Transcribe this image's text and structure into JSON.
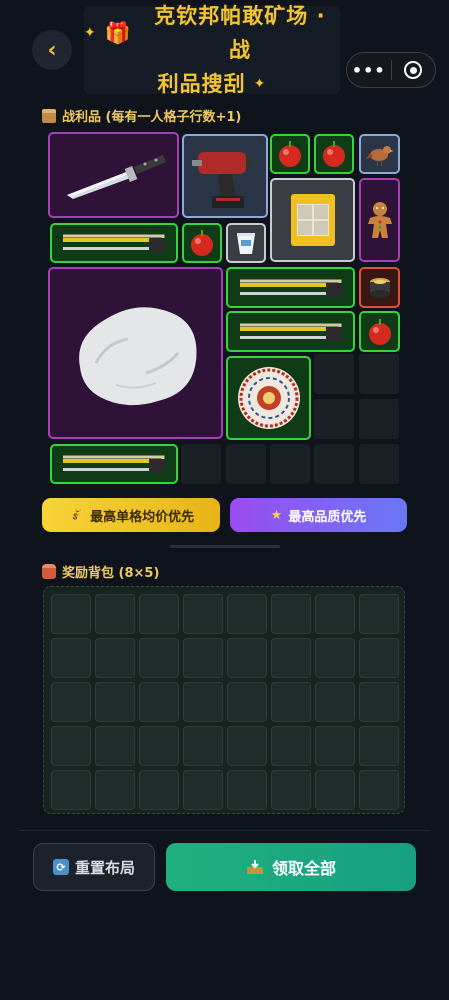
{
  "header": {
    "back_icon": "chevron-left-icon",
    "title_line1": "克钦邦帕敢矿场 · 战",
    "title_line2": "利品搜刮",
    "title_emoji": "🎁",
    "capsule_more": "•••",
    "accent": "#f4c430"
  },
  "loot_section": {
    "label": "战利品 (每有一人格子行数+1)",
    "items": [
      {
        "name": "knife",
        "rarity": "purple"
      },
      {
        "name": "drill",
        "rarity": "blue"
      },
      {
        "name": "apple",
        "rarity": "green"
      },
      {
        "name": "apple",
        "rarity": "green"
      },
      {
        "name": "bird",
        "rarity": "blue"
      },
      {
        "name": "wax-box",
        "rarity": "gray"
      },
      {
        "name": "gingerbread",
        "rarity": "purple"
      },
      {
        "name": "hacksaw",
        "rarity": "green"
      },
      {
        "name": "apple",
        "rarity": "green"
      },
      {
        "name": "cup",
        "rarity": "gray"
      },
      {
        "name": "rock",
        "rarity": "purple"
      },
      {
        "name": "hacksaw",
        "rarity": "green"
      },
      {
        "name": "jar",
        "rarity": "red"
      },
      {
        "name": "hacksaw",
        "rarity": "green"
      },
      {
        "name": "apple",
        "rarity": "green"
      },
      {
        "name": "plate",
        "rarity": "green"
      },
      {
        "name": "hacksaw",
        "rarity": "green"
      }
    ]
  },
  "sort_buttons": {
    "avg_price": "最高单格均价优先",
    "avg_price_icon": "coin-bag-icon",
    "quality": "最高品质优先",
    "quality_icon": "star-icon"
  },
  "backpack": {
    "label": "奖励背包 (8×5)",
    "cols": 8,
    "rows": 5
  },
  "footer": {
    "reset": "重置布局",
    "reset_icon": "refresh-icon",
    "claim": "领取全部",
    "claim_icon": "inbox-tray-icon"
  },
  "colors": {
    "rarity_green": "#36d43a",
    "rarity_purple": "#a640b8",
    "rarity_blue": "#8ea8d8",
    "rarity_gray": "#c9ccd2",
    "rarity_red": "#e0503a",
    "claim": "#1fb07e"
  }
}
